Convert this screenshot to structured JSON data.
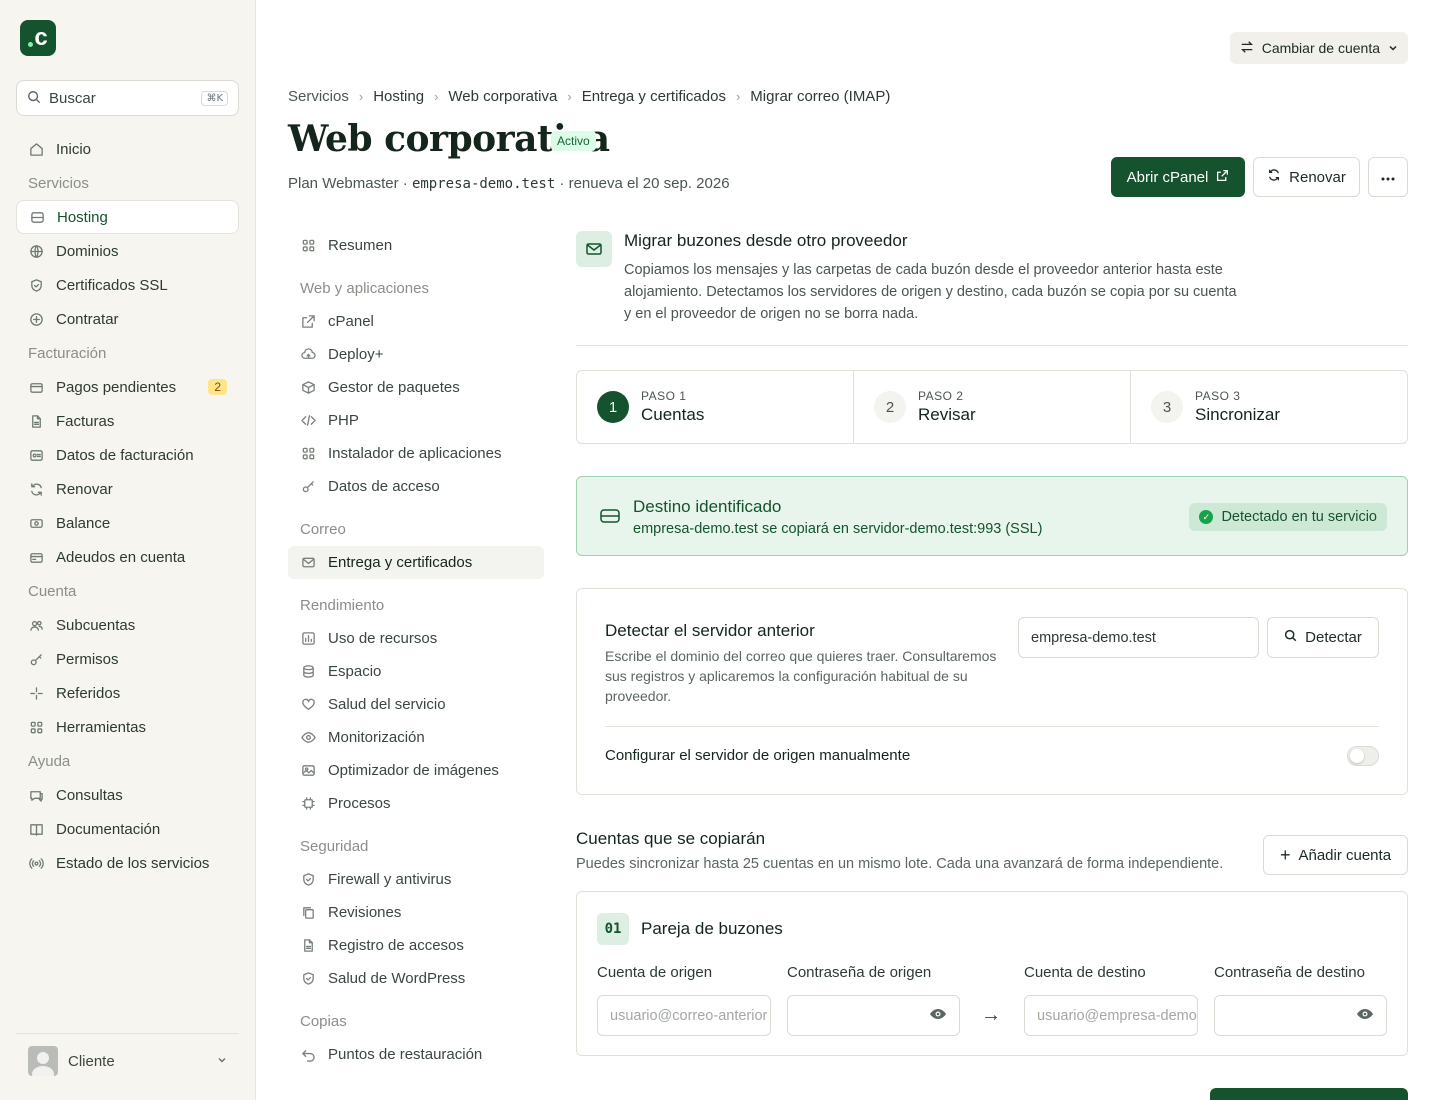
{
  "sidebar": {
    "logo": "c",
    "search": {
      "placeholder": "Buscar",
      "shortcut": "⌘K"
    },
    "nav": [
      {
        "type": "item",
        "label": "Inicio",
        "icon": "home-icon"
      },
      {
        "type": "section",
        "label": "Servicios"
      },
      {
        "type": "item",
        "label": "Hosting",
        "icon": "server-icon",
        "active": true
      },
      {
        "type": "item",
        "label": "Dominios",
        "icon": "globe-icon"
      },
      {
        "type": "item",
        "label": "Certificados SSL",
        "icon": "shield-icon"
      },
      {
        "type": "item",
        "label": "Contratar",
        "icon": "plus-circle-icon"
      },
      {
        "type": "section",
        "label": "Facturación"
      },
      {
        "type": "item",
        "label": "Pagos pendientes",
        "icon": "wallet-icon",
        "badge": "2"
      },
      {
        "type": "item",
        "label": "Facturas",
        "icon": "file-icon"
      },
      {
        "type": "item",
        "label": "Datos de facturación",
        "icon": "id-card-icon"
      },
      {
        "type": "item",
        "label": "Renovar",
        "icon": "refresh-icon"
      },
      {
        "type": "item",
        "label": "Balance",
        "icon": "banknote-icon"
      },
      {
        "type": "item",
        "label": "Adeudos en cuenta",
        "icon": "credit-card-icon"
      },
      {
        "type": "section",
        "label": "Cuenta"
      },
      {
        "type": "item",
        "label": "Subcuentas",
        "icon": "users-icon"
      },
      {
        "type": "item",
        "label": "Permisos",
        "icon": "key-icon"
      },
      {
        "type": "item",
        "label": "Referidos",
        "icon": "sparkles-icon"
      },
      {
        "type": "item",
        "label": "Herramientas",
        "icon": "grid-icon"
      },
      {
        "type": "section",
        "label": "Ayuda"
      },
      {
        "type": "item",
        "label": "Consultas",
        "icon": "chat-icon"
      },
      {
        "type": "item",
        "label": "Documentación",
        "icon": "book-icon"
      },
      {
        "type": "item",
        "label": "Estado de los servicios",
        "icon": "broadcast-icon"
      }
    ],
    "user": {
      "name": "Cliente"
    }
  },
  "header": {
    "switch_account": "Cambiar de cuenta",
    "breadcrumb": [
      "Servicios",
      "Hosting",
      "Web corporativa",
      "Entrega y certificados",
      "Migrar correo (IMAP)"
    ],
    "title": "Web corporativa",
    "status": "Activo",
    "subtitle": {
      "plan": "Plan Webmaster",
      "domain": "empresa-demo.test",
      "renew": "renueva el 20 sep. 2026"
    },
    "open_cpanel": "Abrir cPanel",
    "renew": "Renovar"
  },
  "subnav": [
    {
      "type": "item",
      "label": "Resumen",
      "icon": "grid-icon"
    },
    {
      "type": "section",
      "label": "Web y aplicaciones"
    },
    {
      "type": "item",
      "label": "cPanel",
      "icon": "external-link-icon"
    },
    {
      "type": "item",
      "label": "Deploy+",
      "icon": "cloud-upload-icon"
    },
    {
      "type": "item",
      "label": "Gestor de paquetes",
      "icon": "package-icon"
    },
    {
      "type": "item",
      "label": "PHP",
      "icon": "code-icon"
    },
    {
      "type": "item",
      "label": "Instalador de aplicaciones",
      "icon": "grid-icon"
    },
    {
      "type": "item",
      "label": "Datos de acceso",
      "icon": "key-icon"
    },
    {
      "type": "section",
      "label": "Correo"
    },
    {
      "type": "item",
      "label": "Entrega y certificados",
      "icon": "mail-icon",
      "active": true
    },
    {
      "type": "section",
      "label": "Rendimiento"
    },
    {
      "type": "item",
      "label": "Uso de recursos",
      "icon": "chart-icon"
    },
    {
      "type": "item",
      "label": "Espacio",
      "icon": "database-icon"
    },
    {
      "type": "item",
      "label": "Salud del servicio",
      "icon": "heart-icon"
    },
    {
      "type": "item",
      "label": "Monitorización",
      "icon": "eye-icon"
    },
    {
      "type": "item",
      "label": "Optimizador de imágenes",
      "icon": "image-icon"
    },
    {
      "type": "item",
      "label": "Procesos",
      "icon": "cpu-icon"
    },
    {
      "type": "section",
      "label": "Seguridad"
    },
    {
      "type": "item",
      "label": "Firewall y antivirus",
      "icon": "shield-icon"
    },
    {
      "type": "item",
      "label": "Revisiones",
      "icon": "copy-icon"
    },
    {
      "type": "item",
      "label": "Registro de accesos",
      "icon": "file-icon"
    },
    {
      "type": "item",
      "label": "Salud de WordPress",
      "icon": "shield-icon"
    },
    {
      "type": "section",
      "label": "Copias"
    },
    {
      "type": "item",
      "label": "Puntos de restauración",
      "icon": "undo-icon"
    }
  ],
  "intro": {
    "title": "Migrar buzones desde otro proveedor",
    "text": "Copiamos los mensajes y las carpetas de cada buzón desde el proveedor anterior hasta este alojamiento. Detectamos los servidores de origen y destino, cada buzón se copia por su cuenta y en el proveedor de origen no se borra nada."
  },
  "steps": [
    {
      "num": "1",
      "kicker": "PASO 1",
      "label": "Cuentas",
      "active": true
    },
    {
      "num": "2",
      "kicker": "PASO 2",
      "label": "Revisar"
    },
    {
      "num": "3",
      "kicker": "PASO 3",
      "label": "Sincronizar"
    }
  ],
  "destination": {
    "title": "Destino identificado",
    "detail": "empresa-demo.test se copiará en servidor-demo.test:993 (SSL)",
    "pill": "Detectado en tu servicio"
  },
  "detect": {
    "title": "Detectar el servidor anterior",
    "text": "Escribe el dominio del correo que quieres traer. Consultaremos sus registros y aplicaremos la configuración habitual de su proveedor.",
    "input_value": "empresa-demo.test",
    "button": "Detectar",
    "manual_label": "Configurar el servidor de origen manualmente",
    "manual_on": false
  },
  "accounts": {
    "title": "Cuentas que se copiarán",
    "desc": "Puedes sincronizar hasta 25 cuentas en un mismo lote. Cada una avanzará de forma independiente.",
    "add_button": "Añadir cuenta",
    "pair": {
      "num": "01",
      "title": "Pareja de buzones",
      "source_label": "Cuenta de origen",
      "source_placeholder": "usuario@correo-anterior",
      "source_pw_label": "Contraseña de origen",
      "dest_label": "Cuenta de destino",
      "dest_placeholder": "usuario@empresa-demo.test",
      "dest_pw_label": "Contraseña de destino"
    }
  },
  "colors": {
    "brand": "#14532d",
    "success_bg": "#e8f5ec",
    "badge": "#fde68a"
  }
}
